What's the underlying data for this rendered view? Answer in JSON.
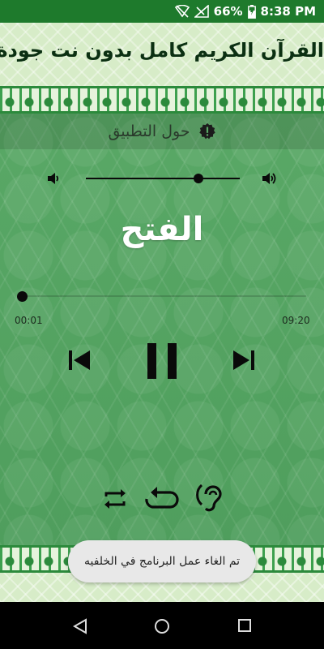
{
  "status_bar": {
    "battery": "66%",
    "time": "8:38 PM"
  },
  "header": {
    "title": "القرآن الكريم كامل بدون نت جودة عالية"
  },
  "about": {
    "label": "حول التطبيق"
  },
  "player": {
    "surah_name": "الفتح",
    "current_time": "00:01",
    "total_time": "09:20",
    "volume_level": 0.73,
    "progress": 0.0
  },
  "toast": {
    "message": "تم الغاء عمل البرنامج في الخلفيه"
  },
  "colors": {
    "status_bar": "#1e7a2c",
    "main_green": "#59a866",
    "header_light": "#d7ecc8",
    "controls": "#0a0a0a"
  },
  "icons": {
    "about": "alert-badge-icon",
    "volume_low": "volume-low-icon",
    "volume_high": "volume-high-icon",
    "prev": "skip-previous-icon",
    "play_pause": "pause-icon",
    "next": "skip-next-icon",
    "repeat": "repeat-icon",
    "replay": "replay-icon",
    "ear": "hearing-icon"
  }
}
